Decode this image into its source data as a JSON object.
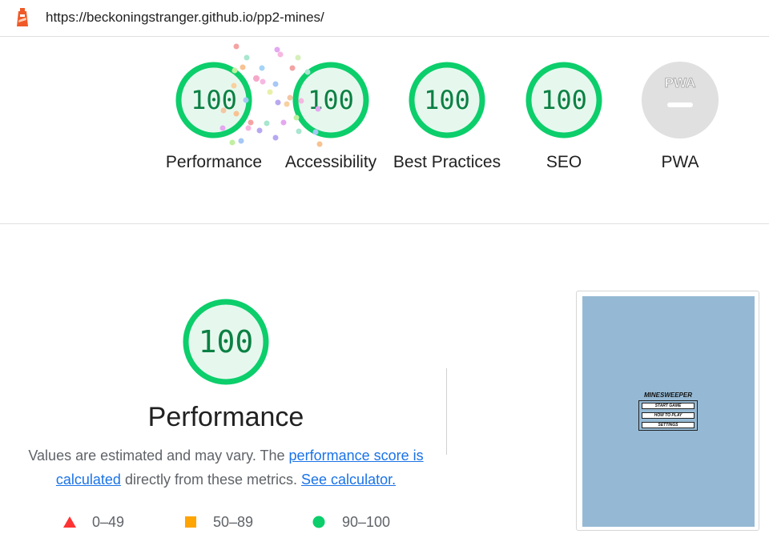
{
  "browser": {
    "url": "https://beckoningstranger.github.io/pp2-mines/",
    "logo_icon": "lighthouse-icon"
  },
  "categories": [
    {
      "label": "Performance",
      "score": "100",
      "status": "pass"
    },
    {
      "label": "Accessibility",
      "score": "100",
      "status": "pass"
    },
    {
      "label": "Best Practices",
      "score": "100",
      "status": "pass"
    },
    {
      "label": "SEO",
      "score": "100",
      "status": "pass"
    },
    {
      "label": "PWA",
      "score": "",
      "badge_text": "PWA",
      "status": "na"
    }
  ],
  "performance": {
    "score": "100",
    "title": "Performance",
    "desc_prefix": "Values are estimated and may vary. The ",
    "desc_link1": "performance score is calculated",
    "desc_middle": " directly from these metrics. ",
    "desc_link2": "See calculator."
  },
  "legend": [
    {
      "range": "0–49",
      "shape": "triangle",
      "color": "#f33"
    },
    {
      "range": "50–89",
      "shape": "square",
      "color": "#ffa400"
    },
    {
      "range": "90–100",
      "shape": "circle",
      "color": "#0cce6b"
    }
  ],
  "screenshot": {
    "title": "MINESWEEPER",
    "buttons": [
      "START GAME",
      "HOW TO PLAY",
      "SETTINGS"
    ]
  },
  "colors": {
    "pass": "#0cce6b",
    "pass_fill": "#e6f8ee",
    "pass_text": "#0b8043",
    "na": "#e0e0e0",
    "link": "#1a73e8"
  }
}
